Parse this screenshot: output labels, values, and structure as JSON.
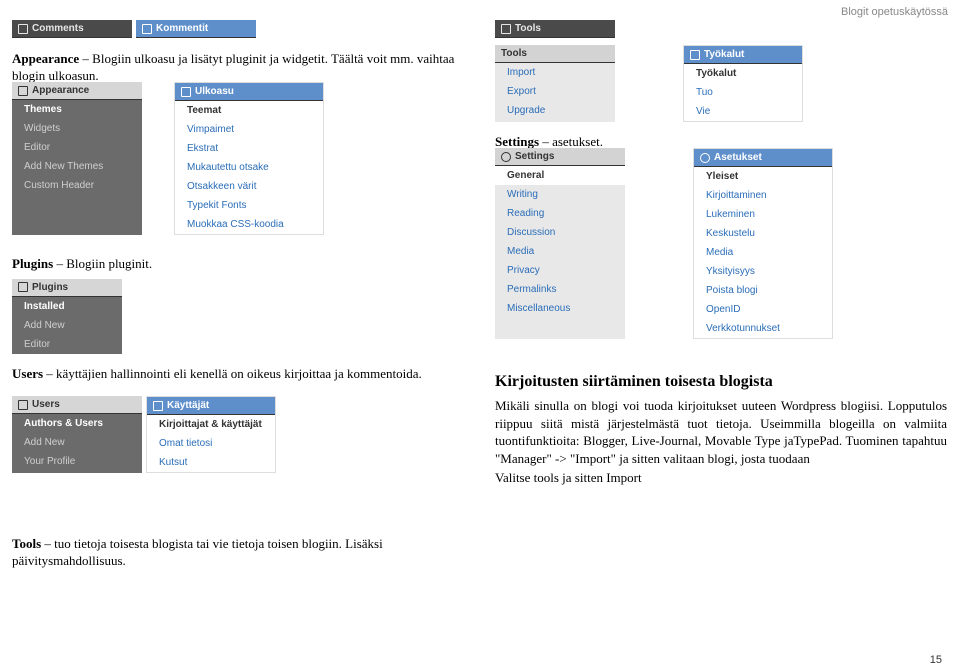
{
  "header_label": "Blogit opetuskäytössä",
  "page_number": "15",
  "top_strip_left": [
    {
      "icon": "comment-icon",
      "label": "Comments"
    },
    {
      "icon": "comment-icon",
      "label": "Kommentit"
    }
  ],
  "top_strip_right": [
    {
      "icon": "tools-icon",
      "label": "Tools"
    }
  ],
  "appearance_text": "Appearance – Blogiin ulkoasu ja lisätyt pluginit ja widgetit. Täältä voit mm. vaihtaa blogin ulkoasun.",
  "appearance_label": "Appearance",
  "menus": {
    "appearance_en": {
      "head": "Appearance",
      "items": [
        "Themes",
        "Widgets",
        "Editor",
        "Add New Themes",
        "Custom Header"
      ]
    },
    "appearance_fi": {
      "head": "Ulkoasu",
      "items": [
        "Teemat",
        "Vimpaimet",
        "Ekstrat",
        "Mukautettu otsake",
        "Otsakkeen värit",
        "Typekit Fonts",
        "Muokkaa CSS-koodia"
      ]
    },
    "plugins_en": {
      "head": "Plugins",
      "items": [
        "Installed",
        "Add New",
        "Editor"
      ]
    },
    "users_en": {
      "head": "Users",
      "items": [
        "Authors & Users",
        "Add New",
        "Your Profile"
      ]
    },
    "users_fi": {
      "head": "Käyttäjät",
      "items_head2": "Kirjoittajat & käyttäjät",
      "items": [
        "Omat tietosi",
        "Kutsut"
      ]
    },
    "tools_fi": {
      "head": "Työkalut",
      "items_head2": "Työkalut",
      "items": [
        "Tuo",
        "Vie"
      ]
    },
    "tools_en_sub": {
      "head": "Tools",
      "items": [
        "Import",
        "Export",
        "Upgrade"
      ]
    },
    "settings_en": {
      "head": "Settings",
      "items": [
        "General",
        "Writing",
        "Reading",
        "Discussion",
        "Media",
        "Privacy",
        "Permalinks",
        "Miscellaneous"
      ]
    },
    "settings_fi": {
      "head": "Asetukset",
      "items_head2": "Yleiset",
      "items": [
        "Kirjoittaminen",
        "Lukeminen",
        "Keskustelu",
        "Media",
        "Yksityisyys",
        "Poista blogi",
        "OpenID",
        "Verkkotunnukset"
      ]
    }
  },
  "plugins_text": "Plugins – Blogiin pluginit.",
  "plugins_label": "Plugins",
  "users_text": "Users – käyttäjien hallinnointi eli kenellä on oikeus kirjoittaa ja kommentoida.",
  "users_label": "Users",
  "tools_text": "Tools – tuo tietoja toisesta blogista tai vie tietoja toisen blogiin. Lisäksi päivitysmahdollisuus.",
  "tools_label": "Tools",
  "settings_text": "Settings – asetukset.",
  "settings_label": "Settings",
  "article": {
    "heading": "Kirjoitusten siirtäminen toisesta blogista",
    "body": "Mikäli sinulla on blogi voi tuoda kirjoitukset uuteen Wordpress blogiisi. Lopputulos riippuu siitä mistä järjestelmästä tuot tietoja. Useimmilla blogeilla on valmiita tuontifunktioita: Blogger, Live-Journal, Movable Type jaTypePad. Tuominen tapahtuu \"Manager\" -> \"Import\" ja sitten valitaan blogi, josta tuodaan",
    "body2": "Valitse tools ja sitten Import"
  }
}
